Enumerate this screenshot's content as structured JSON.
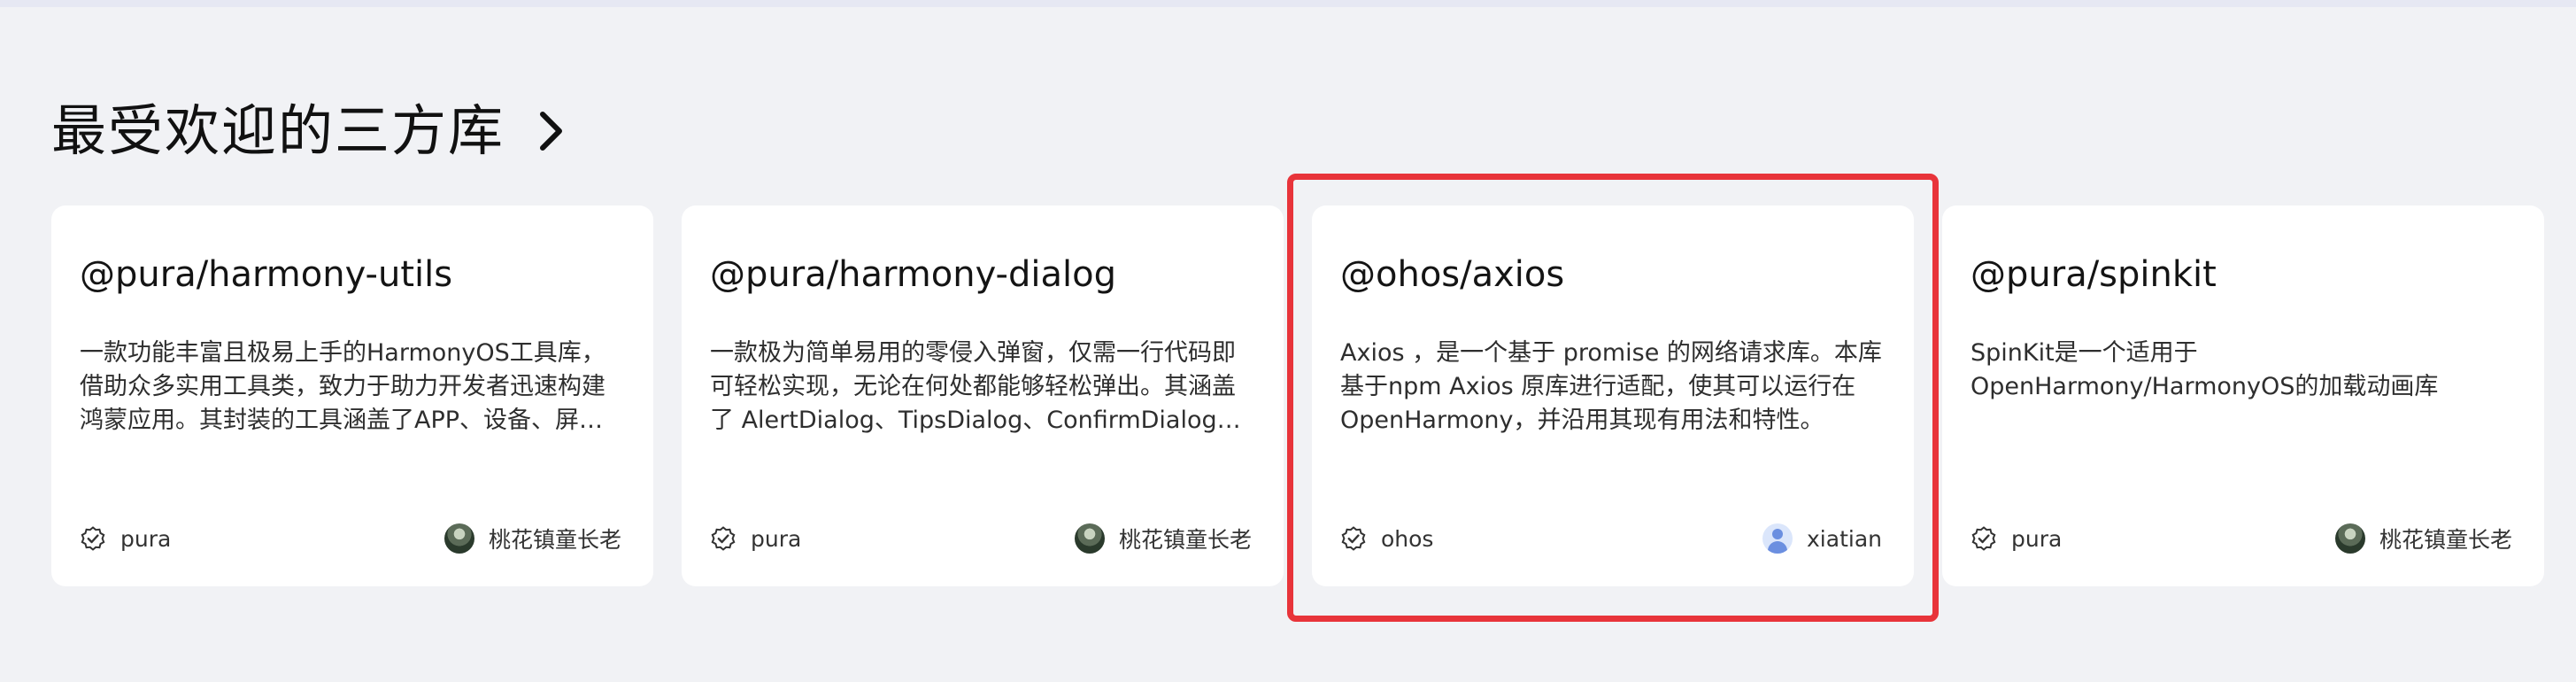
{
  "section": {
    "title": "最受欢迎的三方库",
    "chevron_icon": "chevron-right-icon"
  },
  "cards": [
    {
      "name": "@pura/harmony-utils",
      "description": "一款功能丰富且极易上手的HarmonyOS工具库，借助众多实用工具类，致力于助力开发者迅速构建鸿蒙应用。其封装的工具涵盖了APP、设备、屏幕、授权、通知、线程间通信、弹框、吐司、生物认证、用户首选项、拍照、相册、扫码、文件、日志，异常捕获、字符、字符串、数字、集合、日期、随机、base64、加密、解密、JSON等一系列的功能和操作",
      "publisher": "pura",
      "author": "桃花镇童长老",
      "avatar_style": "dark",
      "selected": false
    },
    {
      "name": "@pura/harmony-dialog",
      "description": "一款极为简单易用的零侵入弹窗，仅需一行代码即可轻松实现，无论在何处都能够轻松弹出。其涵盖了 AlertDialog、TipsDialog、ConfirmDialog、SelectDialog、CustomContentDialog、TextInputDialog、TextAreaDialog、BottomSheetDialog、ActionSheetDialog、CustomDialog、LoadingDialog、LoadingProgress、Toast、ToastTip等多种类型",
      "publisher": "pura",
      "author": "桃花镇童长老",
      "avatar_style": "dark",
      "selected": false
    },
    {
      "name": "@ohos/axios",
      "description": "Axios ，是一个基于 promise 的网络请求库。本库基于npm Axios 原库进行适配，使其可以运行在OpenHarmony，并沿用其现有用法和特性。",
      "publisher": "ohos",
      "author": "xiatian",
      "avatar_style": "light",
      "selected": true
    },
    {
      "name": "@pura/spinkit",
      "description": "SpinKit是一个适用于OpenHarmony/HarmonyOS的加载动画库",
      "publisher": "pura",
      "author": "桃花镇童长老",
      "avatar_style": "dark",
      "selected": false
    }
  ],
  "colors": {
    "page_background": "#f1f2f5",
    "card_background": "#ffffff",
    "selection_border": "#e8343a"
  }
}
